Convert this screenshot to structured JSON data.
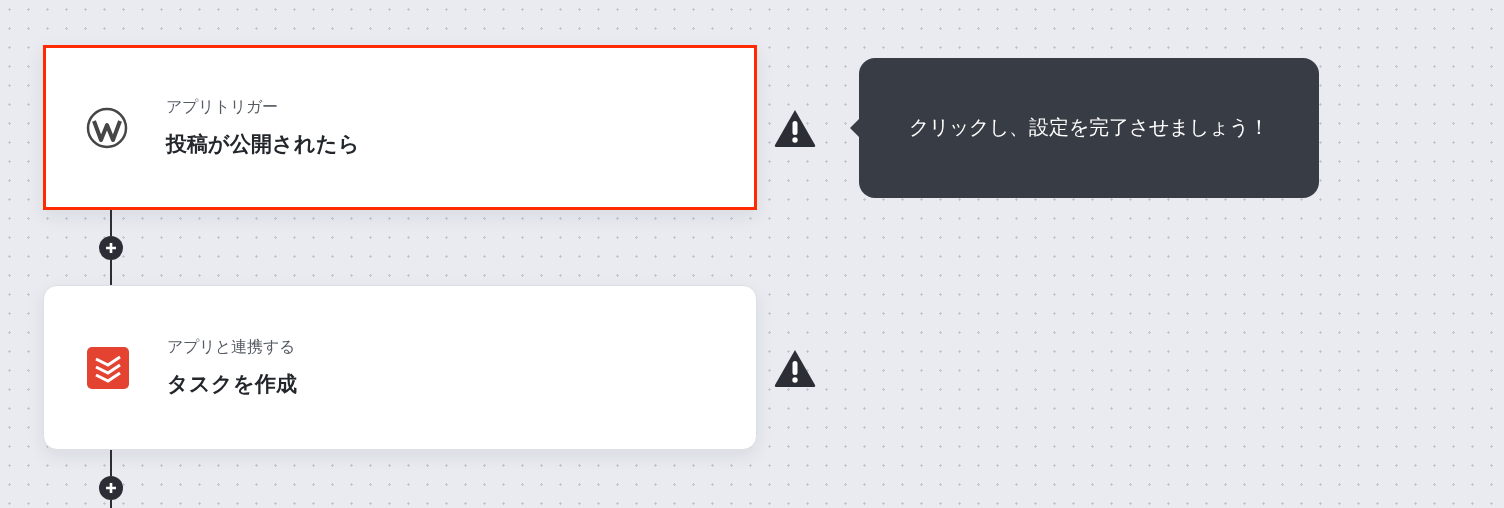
{
  "steps": [
    {
      "kind": "wordpress",
      "label": "アプリトリガー",
      "title": "投稿が公開されたら",
      "selected": true,
      "warning": true,
      "tooltip": "クリックし、設定を完了させましょう！"
    },
    {
      "kind": "todoist",
      "label": "アプリと連携する",
      "title": "タスクを作成",
      "selected": false,
      "warning": true
    }
  ]
}
